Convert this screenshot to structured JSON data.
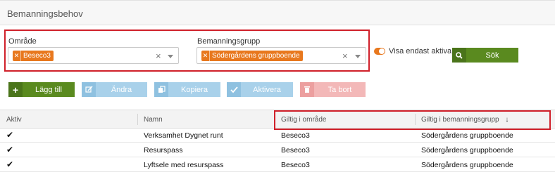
{
  "panel": {
    "title": "Bemanningsbehov"
  },
  "filters": {
    "omrade": {
      "label": "Område",
      "tags": [
        "Beseco3"
      ]
    },
    "grupp": {
      "label": "Bemanningsgrupp",
      "tags": [
        "Södergårdens gruppboende"
      ]
    },
    "active_only": {
      "label": "Visa endast aktiva",
      "on": true
    },
    "search_button": "Sök"
  },
  "toolbar": {
    "add": "Lägg till",
    "edit": "Ändra",
    "copy": "Kopiera",
    "activate": "Aktivera",
    "delete": "Ta bort"
  },
  "colors": {
    "accent": "#e8781e",
    "green": "#5a8a1f",
    "blue": "#8fc1e0",
    "red": "#f0a7a7",
    "highlight": "#d0202a"
  },
  "table": {
    "columns": [
      "Aktiv",
      "Namn",
      "Giltig i område",
      "Giltig i bemanningsgrupp"
    ],
    "sort_indicator": "↓",
    "rows": [
      {
        "active": true,
        "name": "Verksamhet Dygnet runt",
        "omrade": "Beseco3",
        "grupp": "Södergårdens gruppboende"
      },
      {
        "active": true,
        "name": "Resurspass",
        "omrade": "Beseco3",
        "grupp": "Södergårdens gruppboende"
      },
      {
        "active": true,
        "name": "Lyftsele med resurspass",
        "omrade": "Beseco3",
        "grupp": "Södergårdens gruppboende"
      }
    ]
  }
}
